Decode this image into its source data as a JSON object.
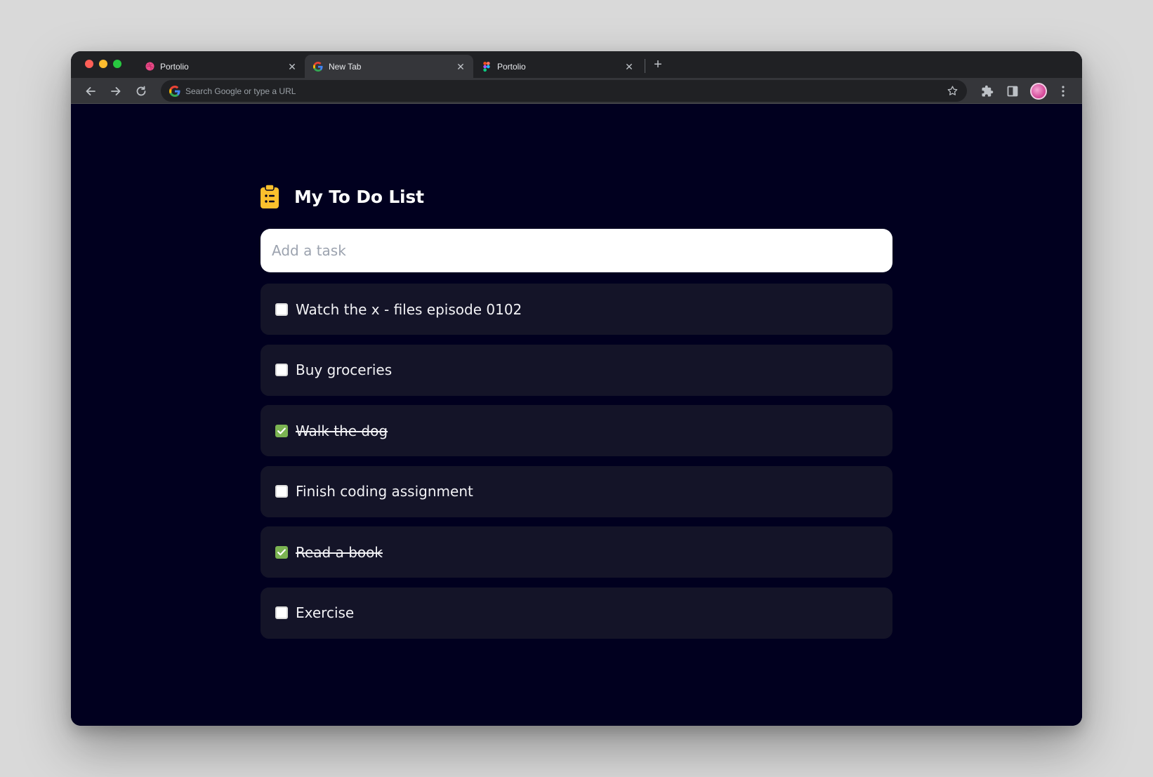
{
  "browser": {
    "tabs": [
      {
        "title": "Portolio",
        "favicon": "dribbble-icon",
        "active": false
      },
      {
        "title": "New Tab",
        "favicon": "google-icon",
        "active": true
      },
      {
        "title": "Portolio",
        "favicon": "figma-icon",
        "active": false
      }
    ],
    "omnibox_placeholder": "Search Google or type a URL"
  },
  "app": {
    "title": "My To Do List",
    "icon": "clipboard-list-icon",
    "accent_color": "#fbc02d",
    "input_placeholder": "Add a task",
    "tasks": [
      {
        "text": "Watch the x - files episode 0102",
        "done": false
      },
      {
        "text": "Buy groceries",
        "done": false
      },
      {
        "text": "Walk the dog",
        "done": true
      },
      {
        "text": "Finish coding assignment",
        "done": false
      },
      {
        "text": "Read a book",
        "done": true
      },
      {
        "text": "Exercise",
        "done": false
      }
    ],
    "colors": {
      "background": "#01001f",
      "card": "#141428",
      "checked": "#7bb352"
    }
  }
}
